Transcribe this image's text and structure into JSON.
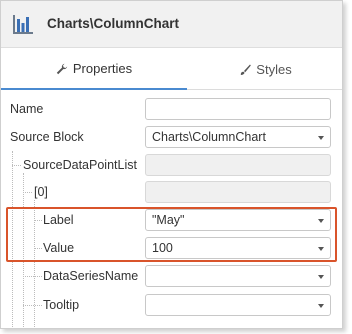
{
  "header": {
    "title": "Charts\\ColumnChart",
    "icon": "column-chart-icon"
  },
  "tabs": [
    {
      "label": "Properties",
      "icon": "wrench-icon",
      "active": true
    },
    {
      "label": "Styles",
      "icon": "brush-icon",
      "active": false
    }
  ],
  "properties": {
    "name": {
      "label": "Name",
      "value": ""
    },
    "source_block": {
      "label": "Source Block",
      "value": "Charts\\ColumnChart"
    },
    "source_data_point_list": {
      "label": "SourceDataPointList",
      "value": ""
    },
    "index0": {
      "label": "[0]",
      "value": ""
    },
    "label": {
      "label": "Label",
      "value": "\"May\""
    },
    "value": {
      "label": "Value",
      "value": "100"
    },
    "data_series_name": {
      "label": "DataSeriesName",
      "value": ""
    },
    "tooltip": {
      "label": "Tooltip",
      "value": ""
    }
  },
  "colors": {
    "highlight": "#d9542b",
    "active_tab": "#4a8ad0",
    "chart_icon": "#3a6fb5"
  }
}
